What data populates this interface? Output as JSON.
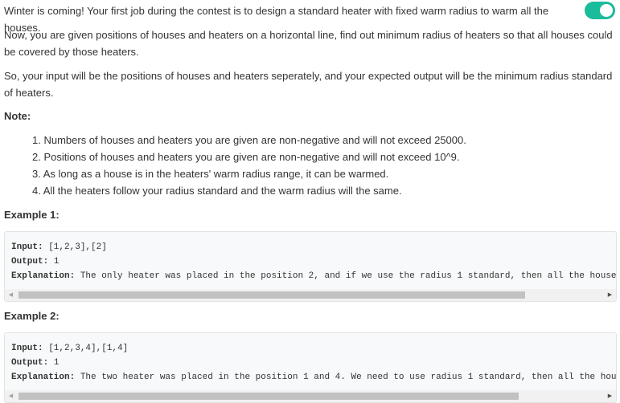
{
  "toggle": {
    "state": "on",
    "color": "#1abc9c"
  },
  "description": {
    "p1": "Winter is coming! Your first job during the contest is to design a standard heater with fixed warm radius to warm all the houses.",
    "p2": "Now, you are given positions of houses and heaters on a horizontal line, find out minimum radius of heaters so that all houses could be covered by those heaters.",
    "p3": "So, your input will be the positions of houses and heaters seperately, and your expected output will be the minimum radius standard of heaters."
  },
  "note": {
    "heading": "Note:",
    "items": [
      "1. Numbers of houses and heaters you are given are non-negative and will not exceed 25000.",
      "2. Positions of houses and heaters you are given are non-negative and will not exceed 10^9.",
      "3. As long as a house is in the heaters' warm radius range, it can be warmed.",
      "4. All the heaters follow your radius standard and the warm radius will the same."
    ]
  },
  "examples": [
    {
      "heading": "Example 1:",
      "input_label": "Input:",
      "input": " [1,2,3],[2]",
      "output_label": "Output:",
      "output": " 1",
      "explanation_label": "Explanation:",
      "explanation": " The only heater was placed in the position 2, and if we use the radius 1 standard, then all the houses can be warmed."
    },
    {
      "heading": "Example 2:",
      "input_label": "Input:",
      "input": " [1,2,3,4],[1,4]",
      "output_label": "Output:",
      "output": " 1",
      "explanation_label": "Explanation:",
      "explanation": " The two heater was placed in the position 1 and 4. We need to use radius 1 standard, then all the houses can be warmed."
    }
  ],
  "scroll": {
    "left_arrow": "◀",
    "right_arrow": "▶"
  }
}
